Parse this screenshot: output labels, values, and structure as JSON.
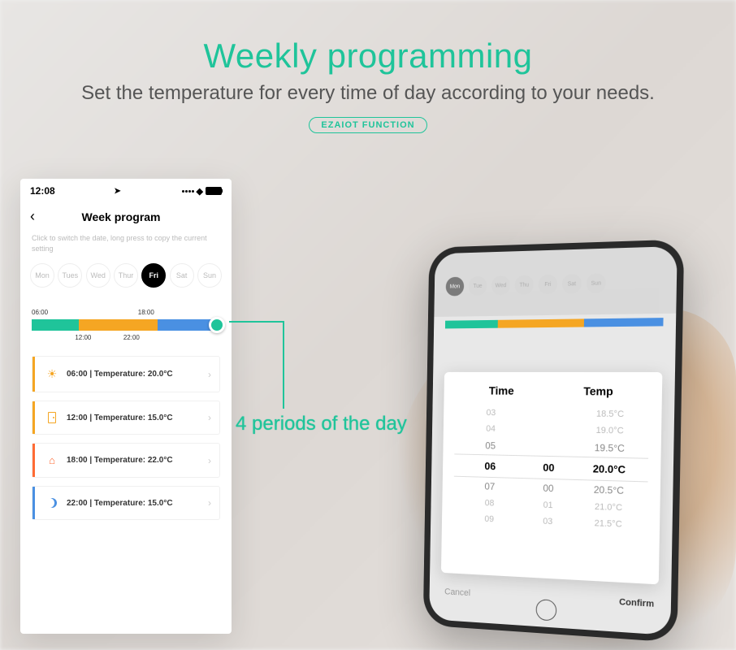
{
  "header": {
    "title": "Weekly programming",
    "subtitle": "Set the temperature for every time of day according to your needs.",
    "badge": "EZAIOT FUNCTION"
  },
  "phone1": {
    "time": "12:08",
    "nav_title": "Week program",
    "hint": "Click to switch the date, long press to copy the current setting",
    "days": [
      "Mon",
      "Tues",
      "Wed",
      "Thur",
      "Fri",
      "Sat",
      "Sun"
    ],
    "active_day": "Fri",
    "timeline": {
      "top_left": "06:00",
      "top_right": "18:00",
      "bottom_left": "12:00",
      "bottom_right": "22:00"
    },
    "periods": [
      {
        "text": "06:00  |  Temperature: 20.0°C"
      },
      {
        "text": "12:00  |  Temperature: 15.0°C"
      },
      {
        "text": "18:00  |  Temperature: 22.0°C"
      },
      {
        "text": "22:00  |  Temperature: 15.0°C"
      }
    ]
  },
  "callout": "4 periods of the day",
  "phone2": {
    "days": [
      "Mon",
      "Tue",
      "Wed",
      "Thu",
      "Fri",
      "Sat",
      "Sun"
    ],
    "picker": {
      "hdr_time": "Time",
      "hdr_temp": "Temp",
      "rows": [
        {
          "h": "03",
          "m": "",
          "t": "18.5°C"
        },
        {
          "h": "04",
          "m": "",
          "t": "19.0°C"
        },
        {
          "h": "05",
          "m": "",
          "t": "19.5°C"
        },
        {
          "h": "06",
          "m": "00",
          "t": "20.0°C"
        },
        {
          "h": "07",
          "m": "00",
          "t": "20.5°C"
        },
        {
          "h": "08",
          "m": "01",
          "t": "21.0°C"
        },
        {
          "h": "09",
          "m": "03",
          "t": "21.5°C"
        }
      ],
      "selected": 3,
      "cancel": "Cancel",
      "confirm": "Confirm"
    }
  }
}
